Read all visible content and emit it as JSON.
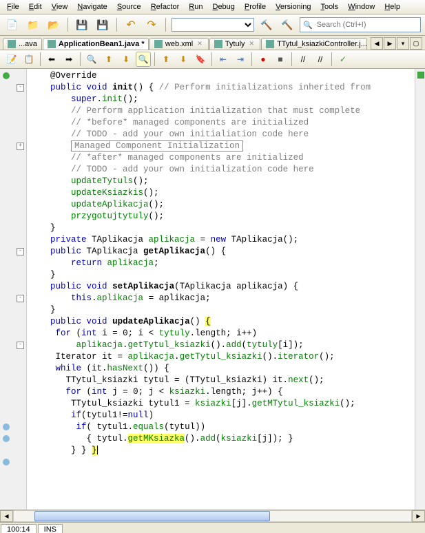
{
  "menu": [
    "File",
    "Edit",
    "View",
    "Navigate",
    "Source",
    "Refactor",
    "Run",
    "Debug",
    "Profile",
    "Versioning",
    "Tools",
    "Window",
    "Help"
  ],
  "search_placeholder": "Search (Ctrl+I)",
  "tabs": [
    {
      "label": "...ava",
      "closable": false,
      "active": false
    },
    {
      "label": "ApplicationBean1.java *",
      "closable": true,
      "active": true
    },
    {
      "label": "web.xml",
      "closable": true,
      "active": false
    },
    {
      "label": "Tytuly",
      "closable": true,
      "active": false
    },
    {
      "label": "TTytul_ksiazkiController.j...",
      "closable": true,
      "active": false
    }
  ],
  "code_lines": [
    {
      "i": 4,
      "t": "    @Override",
      "cls": "ann-j",
      "ann": "green"
    },
    {
      "i": 4,
      "t": "    <kw>public</kw> <kw>void</kw> <fn>init</fn>() { <cm>// Perform initializations inherited from </cm>",
      "fold": "-"
    },
    {
      "i": 8,
      "t": "        <kw>super</kw>.<call>init</call>();"
    },
    {
      "i": 8,
      "t": "        <cm>// Perform application initialization that must complete</cm>"
    },
    {
      "i": 8,
      "t": "        <cm>// *before* managed components are initialized</cm>"
    },
    {
      "i": 8,
      "t": "        <cm>// TODO - add your own initialiation code here</cm>"
    },
    {
      "i": 8,
      "t": "        <span class=\"box cm\">Managed Component Initialization</span>",
      "fold": "+"
    },
    {
      "i": 8,
      "t": "        <cm>// *after* managed components are initialized</cm>"
    },
    {
      "i": 8,
      "t": "        <cm>// TODO - add your own initialization code here</cm>"
    },
    {
      "i": 8,
      "t": "        <call>updateTytuls</call>();"
    },
    {
      "i": 8,
      "t": "        <call>updateKsiazkis</call>();"
    },
    {
      "i": 8,
      "t": "        <call>updateAplikacja</call>();"
    },
    {
      "i": 8,
      "t": "        <call>przygotujtytuly</call>();"
    },
    {
      "i": 4,
      "t": "    }"
    },
    {
      "i": 4,
      "t": "    <kw>private</kw> TAplikacja <call>aplikacja</call> = <kw>new</kw> TAplikacja();"
    },
    {
      "i": 4,
      "t": "    <kw>public</kw> TAplikacja <fn>getAplikacja</fn>() {",
      "fold": "-"
    },
    {
      "i": 8,
      "t": "        <kw>return</kw> <call>aplikacja</call>;"
    },
    {
      "i": 4,
      "t": "    }"
    },
    {
      "i": 0,
      "t": ""
    },
    {
      "i": 4,
      "t": "    <kw>public</kw> <kw>void</kw> <fn>setAplikacja</fn>(TAplikacja aplikacja) {",
      "fold": "-"
    },
    {
      "i": 8,
      "t": "        <kw>this</kw>.<call>aplikacja</call> = aplikacja;"
    },
    {
      "i": 4,
      "t": "    }"
    },
    {
      "i": 0,
      "t": ""
    },
    {
      "i": 4,
      "t": "    <kw>public</kw> <kw>void</kw> <fn>updateAplikacja</fn>() <hl>{</hl>",
      "fold": "-"
    },
    {
      "i": 5,
      "t": "     <kw>for</kw> (<kw>int</kw> i = 0; i &lt; <call>tytuly</call>.length; i++)"
    },
    {
      "i": 9,
      "t": "         <call>aplikacja</call>.<call>getTytul_ksiazki</call>().<call>add</call>(<call>tytuly</call>[i]);"
    },
    {
      "i": 5,
      "t": "     Iterator it = <call>aplikacja</call>.<call>getTytul_ksiazki</call>().<call>iterator</call>();"
    },
    {
      "i": 5,
      "t": "     <kw>while</kw> (it.<call>hasNext</call>()) {"
    },
    {
      "i": 7,
      "t": "       TTytul_ksiazki tytul = (TTytul_ksiazki) it.<call>next</call>();"
    },
    {
      "i": 7,
      "t": "       <kw>for</kw> (<kw>int</kw> j = 0; j &lt; <call>ksiazki</call>.length; j++) {"
    },
    {
      "i": 8,
      "t": "        TTytul_ksiazki tytul1 = <call>ksiazki</call>[j].<call>getMTytul_ksiazki</call>();",
      "ann": "blue"
    },
    {
      "i": 8,
      "t": "        <kw>if</kw>(tytul1!=<kw>null</kw>)",
      "ann": "blue"
    },
    {
      "i": 9,
      "t": "         <kw>if</kw>( tytul1.<call>equals</call>(tytul))"
    },
    {
      "i": 11,
      "t": "           { tytul.<hl><call>getMKsiazka</call></hl>().<call>add</call>(<call>ksiazki</call>[j]); }",
      "ann": "blue"
    },
    {
      "i": 8,
      "t": "        } } <hl>}</hl><span class=\"cursor\"></span>"
    }
  ],
  "status": {
    "pos": "100:14",
    "mode": "INS"
  }
}
